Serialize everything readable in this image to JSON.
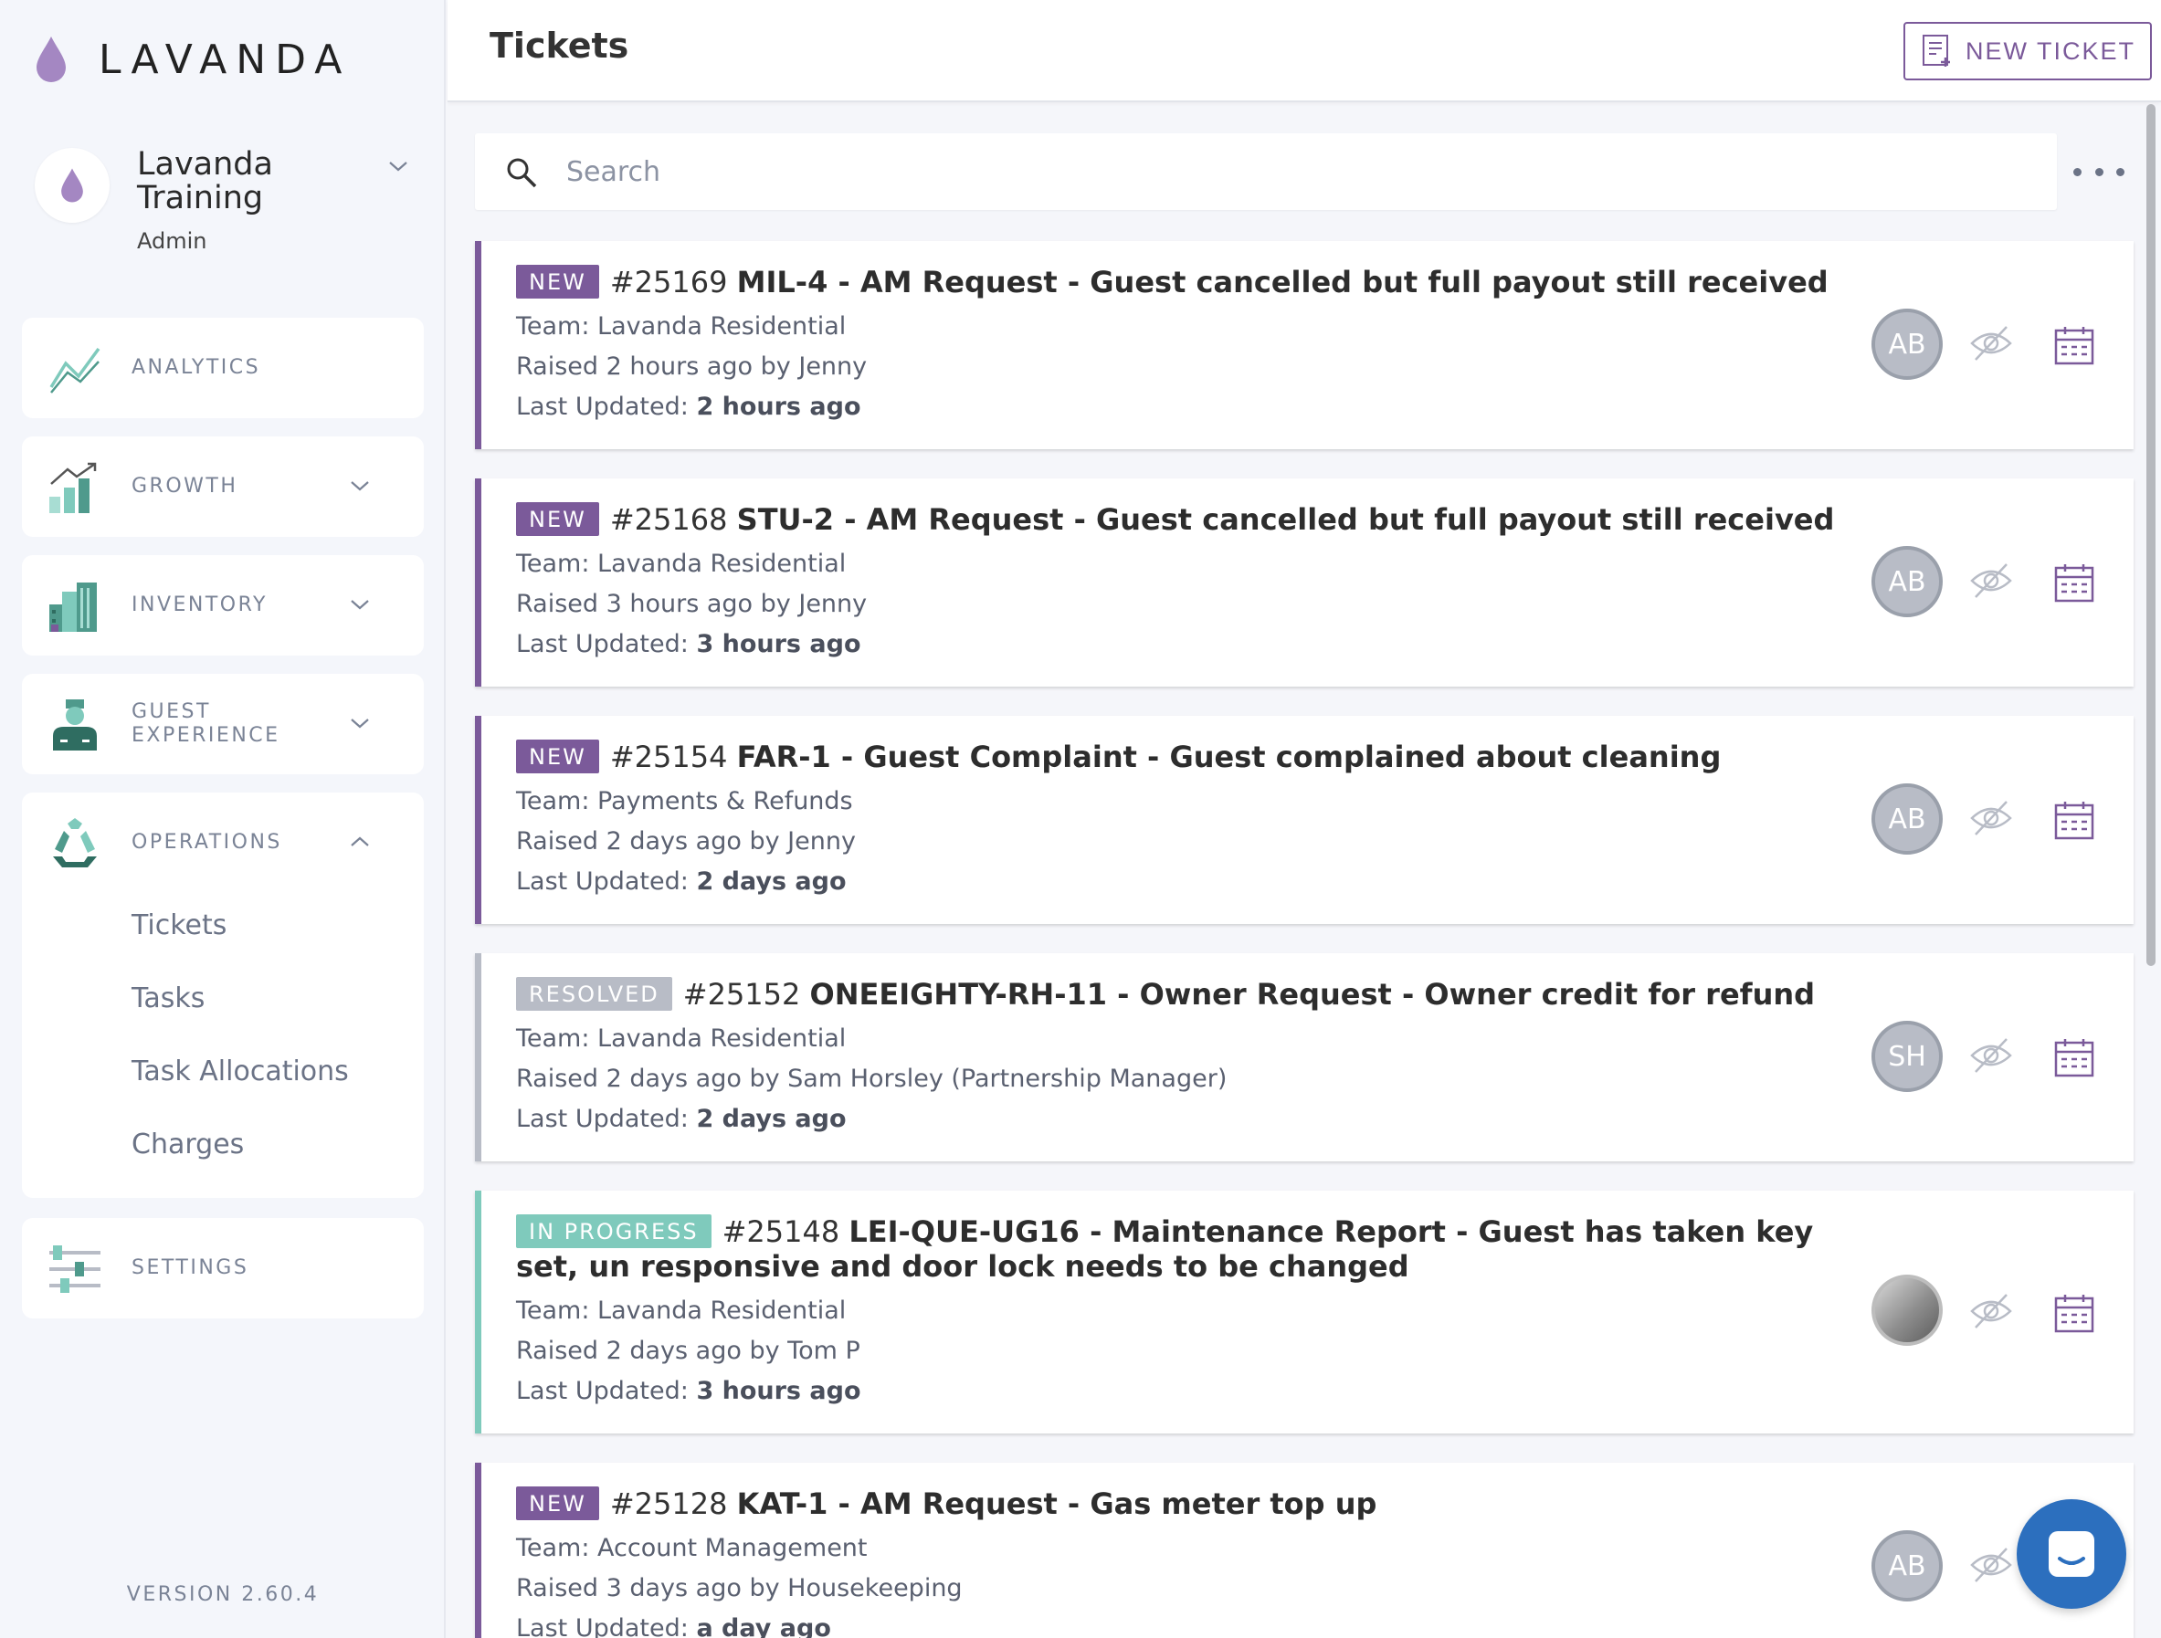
{
  "brand": {
    "name": "LAVANDA",
    "accent": "#7b5a9a",
    "teal": "#7fcabc",
    "gray": "#b8bcc6"
  },
  "account": {
    "name": "Lavanda Training",
    "role": "Admin"
  },
  "nav": {
    "analytics": "ANALYTICS",
    "growth": "GROWTH",
    "inventory": "INVENTORY",
    "guest_experience": "GUEST EXPERIENCE",
    "operations": "OPERATIONS",
    "operations_items": [
      "Tickets",
      "Tasks",
      "Task Allocations",
      "Charges"
    ],
    "settings": "SETTINGS"
  },
  "version": "VERSION 2.60.4",
  "header": {
    "title": "Tickets",
    "new_ticket_label": "NEW TICKET"
  },
  "search": {
    "placeholder": "Search"
  },
  "tickets": [
    {
      "status": "NEW",
      "number": "#25169",
      "subject": "MIL-4 - AM Request - Guest cancelled but full payout still received",
      "team": "Team: Lavanda Residential",
      "raised": "Raised 2 hours ago by Jenny",
      "updated_label": "Last Updated:",
      "updated_value": "2 hours ago",
      "assignee": "AB"
    },
    {
      "status": "NEW",
      "number": "#25168",
      "subject": "STU-2 - AM Request - Guest cancelled but full payout still received",
      "team": "Team: Lavanda Residential",
      "raised": "Raised 3 hours ago by Jenny",
      "updated_label": "Last Updated:",
      "updated_value": "3 hours ago",
      "assignee": "AB"
    },
    {
      "status": "NEW",
      "number": "#25154",
      "subject": "FAR-1 - Guest Complaint - Guest complained about cleaning",
      "team": "Team: Payments & Refunds",
      "raised": "Raised 2 days ago by Jenny",
      "updated_label": "Last Updated:",
      "updated_value": "2 days ago",
      "assignee": "AB"
    },
    {
      "status": "RESOLVED",
      "number": "#25152",
      "subject": "ONEEIGHTY-RH-11 - Owner Request - Owner credit for refund",
      "team": "Team: Lavanda Residential",
      "raised": "Raised 2 days ago by Sam Horsley (Partnership Manager)",
      "updated_label": "Last Updated:",
      "updated_value": "2 days ago",
      "assignee": "SH"
    },
    {
      "status": "IN PROGRESS",
      "number": "#25148",
      "subject": "LEI-QUE-UG16 - Maintenance Report - Guest has taken key set, un responsive and door lock needs to be changed",
      "team": "Team: Lavanda Residential",
      "raised": "Raised 2 days ago by Tom P",
      "updated_label": "Last Updated:",
      "updated_value": "3 hours ago",
      "assignee": ""
    },
    {
      "status": "NEW",
      "number": "#25128",
      "subject": "KAT-1 - AM Request - Gas meter top up",
      "team": "Team: Account Management",
      "raised": "Raised 3 days ago by Housekeeping",
      "updated_label": "Last Updated:",
      "updated_value": "a day ago",
      "assignee": "AB"
    }
  ]
}
